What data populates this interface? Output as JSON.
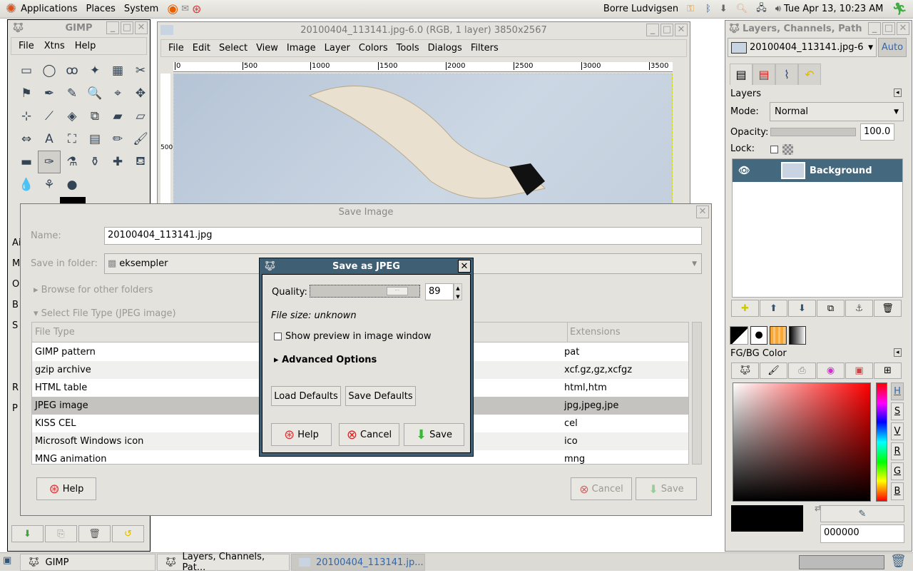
{
  "top_panel": {
    "menus": [
      "Applications",
      "Places",
      "System"
    ],
    "user": "Borre Ludvigsen",
    "clock": "Tue Apr 13, 10:23 AM",
    "launchers": [
      "firefox-icon",
      "mail-clock-icon",
      "help-lifebuoy-icon"
    ],
    "tray": [
      "keyring-icon",
      "bluetooth-icon",
      "update-icon",
      "search-icon",
      "network-icon",
      "volume-icon",
      "logout-icon"
    ]
  },
  "toolbox": {
    "title": "GIMP",
    "menu": [
      "File",
      "Xtns",
      "Help"
    ],
    "tools": [
      "▭",
      "◯",
      "ꝏ",
      "✦",
      "▦",
      "✂",
      "⚑",
      "✒",
      "✎",
      "🔍",
      "⌖",
      "✥",
      "⊹",
      "⟋",
      "◈",
      "⧉",
      "▰",
      "▱",
      "⇔",
      "A",
      "⛶",
      "▤",
      "✏",
      "🖌",
      "▬",
      "✑",
      "⚗",
      "⚱",
      "✚",
      "⛾",
      "💧",
      "⚘",
      "●"
    ],
    "options_letters": [
      "Ai",
      "M",
      "O",
      "B",
      "S",
      "R",
      "P"
    ]
  },
  "image_window": {
    "title": "20100404_113141.jpg-6.0 (RGB, 1 layer) 3850x2567",
    "menu": [
      "File",
      "Edit",
      "Select",
      "View",
      "Image",
      "Layer",
      "Colors",
      "Tools",
      "Dialogs",
      "Filters"
    ],
    "ruler_ticks": [
      "0",
      "500",
      "1000",
      "1500",
      "2000",
      "2500",
      "3000",
      "3500"
    ],
    "vruler": "500"
  },
  "save_image": {
    "title": "Save Image",
    "name_label": "Name:",
    "name_value": "20100404_113141.jpg",
    "folder_label": "Save in folder:",
    "folder_value": "eksempler",
    "browse": "Browse for other folders",
    "select_type": "Select File Type (JPEG image)",
    "columns": [
      "File Type",
      "Extensions"
    ],
    "rows": [
      {
        "type": "GIMP pattern",
        "ext": "pat"
      },
      {
        "type": "gzip archive",
        "ext": "xcf.gz,gz,xcfgz"
      },
      {
        "type": "HTML table",
        "ext": "html,htm"
      },
      {
        "type": "JPEG image",
        "ext": "jpg,jpeg,jpe",
        "selected": true
      },
      {
        "type": "KISS CEL",
        "ext": "cel"
      },
      {
        "type": "Microsoft Windows icon",
        "ext": "ico"
      },
      {
        "type": "MNG animation",
        "ext": "mng"
      }
    ],
    "help": "Help",
    "cancel": "Cancel",
    "save": "Save"
  },
  "jpeg_dialog": {
    "title": "Save as JPEG",
    "quality_label": "Quality:",
    "quality": 89,
    "file_size": "File size: unknown",
    "preview_label": "Show preview in image window",
    "preview_checked": false,
    "advanced": "Advanced Options",
    "load_defaults": "Load Defaults",
    "save_defaults": "Save Defaults",
    "help": "Help",
    "cancel": "Cancel",
    "save": "Save"
  },
  "dock": {
    "title": "Layers, Channels, Path",
    "image_select": "20100404_113141.jpg-6",
    "auto": "Auto",
    "layers_title": "Layers",
    "mode_label": "Mode:",
    "mode": "Normal",
    "opacity_label": "Opacity:",
    "opacity": "100.0",
    "lock_label": "Lock:",
    "layer_name": "Background",
    "fgbg_title": "FG/BG Color",
    "channels": [
      "H",
      "S",
      "V",
      "R",
      "G",
      "B"
    ],
    "hex": "000000",
    "fg_color": "#000000",
    "bg_color": "#ffffff"
  },
  "taskbar": {
    "items": [
      "GIMP",
      "Layers, Channels, Pat...",
      "20100404_113141.jp..."
    ]
  }
}
